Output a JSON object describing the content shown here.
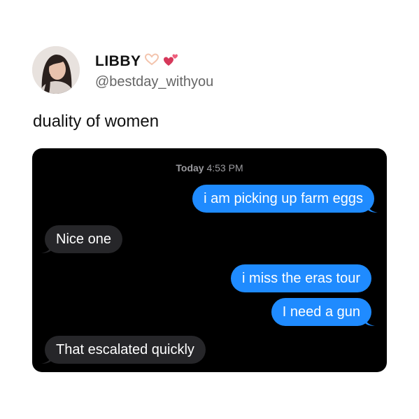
{
  "profile": {
    "name": "LIBBY",
    "handle": "@bestday_withyou",
    "icons": [
      "heart-hands-icon",
      "two-hearts-icon"
    ]
  },
  "tweet": {
    "text": "duality of women"
  },
  "chat": {
    "timestamp_day": "Today",
    "timestamp_time": "4:53 PM",
    "messages": [
      {
        "side": "sent",
        "text": "i am picking up farm eggs"
      },
      {
        "side": "received",
        "text": "Nice one"
      },
      {
        "side": "sent",
        "text": "i miss the eras tour"
      },
      {
        "side": "sent",
        "text": "I need a gun"
      },
      {
        "side": "received",
        "text": "That escalated quickly"
      }
    ]
  },
  "colors": {
    "sent_bubble": "#1f8bff",
    "received_bubble": "#262629",
    "chat_background": "#000000"
  }
}
